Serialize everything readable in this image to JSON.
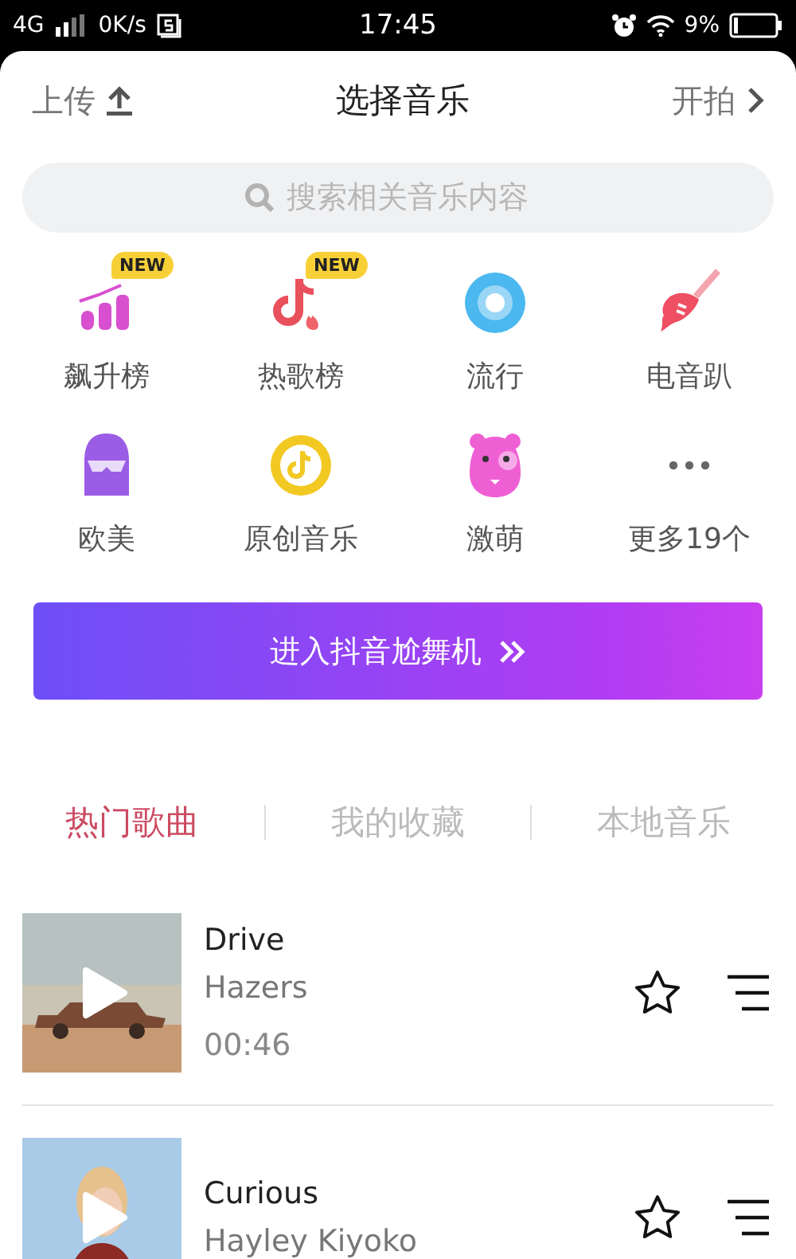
{
  "status_bar": {
    "network": "4G",
    "speed": "0K/s",
    "time": "17:45",
    "battery": "9%"
  },
  "header": {
    "left": "上传",
    "title": "选择音乐",
    "right": "开拍"
  },
  "search": {
    "placeholder": "搜索相关音乐内容"
  },
  "categories": [
    {
      "label": "飙升榜",
      "badge": "NEW"
    },
    {
      "label": "热歌榜",
      "badge": "NEW"
    },
    {
      "label": "流行"
    },
    {
      "label": "电音趴"
    },
    {
      "label": "欧美"
    },
    {
      "label": "原创音乐"
    },
    {
      "label": "激萌"
    },
    {
      "label": "更多19个"
    }
  ],
  "banner": {
    "label": "进入抖音尬舞机"
  },
  "tabs": [
    {
      "label": "热门歌曲",
      "selected": true
    },
    {
      "label": "我的收藏",
      "selected": false
    },
    {
      "label": "本地音乐",
      "selected": false
    }
  ],
  "songs": [
    {
      "title": "Drive",
      "artist": "Hazers",
      "duration": "00:46"
    },
    {
      "title": "Curious",
      "artist": "Hayley Kiyoko"
    }
  ]
}
